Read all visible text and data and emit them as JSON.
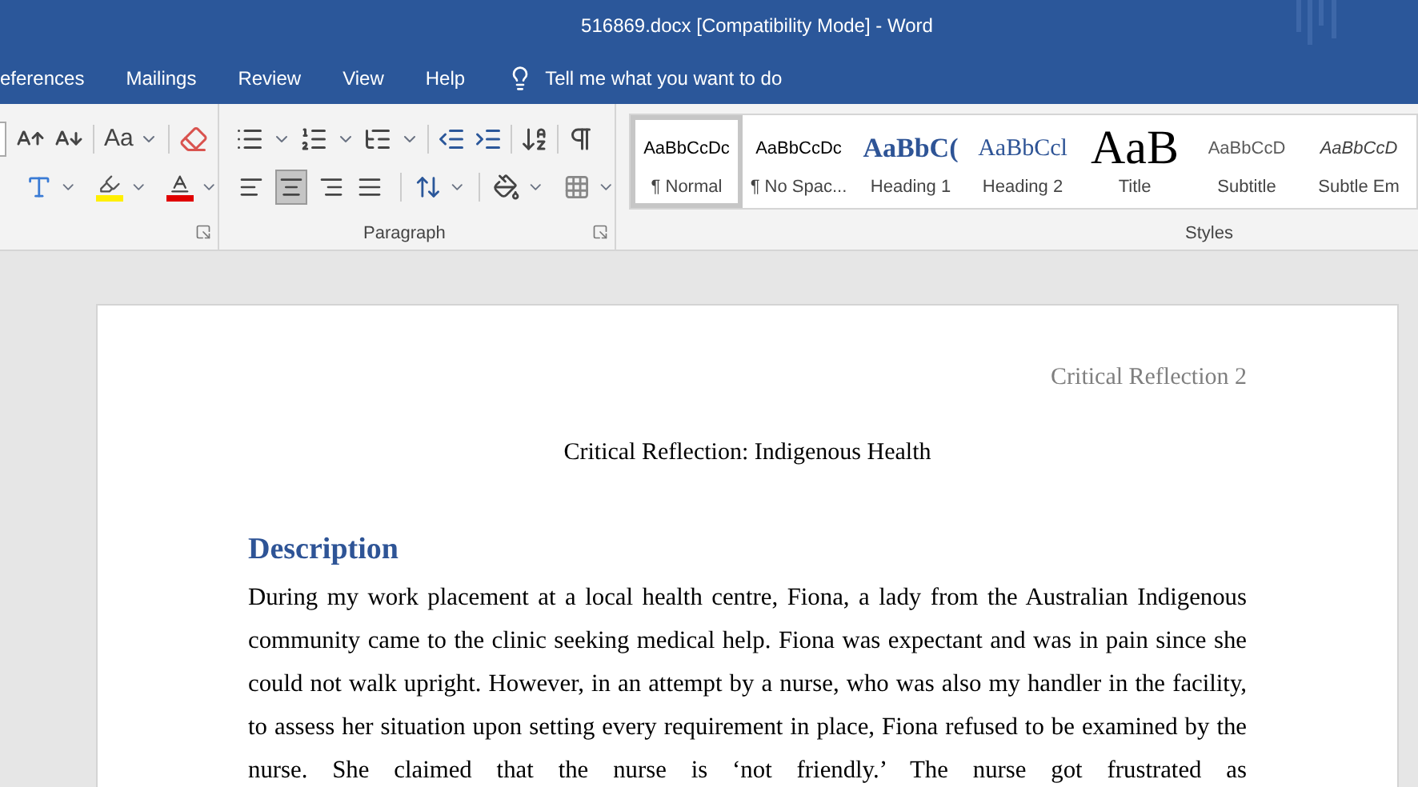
{
  "window": {
    "title": "516869.docx [Compatibility Mode]  -  Word"
  },
  "tabs": [
    {
      "label": "eferences"
    },
    {
      "label": "Mailings"
    },
    {
      "label": "Review"
    },
    {
      "label": "View"
    },
    {
      "label": "Help"
    }
  ],
  "tell_me": {
    "placeholder": "Tell me what you want to do"
  },
  "font_group": {
    "change_case": "Aa"
  },
  "paragraph_group": {
    "label": "Paragraph",
    "alignment": [
      {
        "kind": "left",
        "selected": false
      },
      {
        "kind": "center",
        "selected": true
      },
      {
        "kind": "right",
        "selected": false
      },
      {
        "kind": "justify",
        "selected": false
      }
    ]
  },
  "styles_group": {
    "label": "Styles",
    "styles": [
      {
        "sample": "AaBbCcDc",
        "name": "¶ Normal",
        "kind": "normal",
        "selected": true
      },
      {
        "sample": "AaBbCcDc",
        "name": "¶ No Spac...",
        "kind": "normal",
        "selected": false
      },
      {
        "sample": "AaBbC(",
        "name": "Heading 1",
        "kind": "heading1",
        "selected": false
      },
      {
        "sample": "AaBbCcl",
        "name": "Heading 2",
        "kind": "heading2",
        "selected": false
      },
      {
        "sample": "AaB",
        "name": "Title",
        "kind": "title",
        "selected": false
      },
      {
        "sample": "AaBbCcD",
        "name": "Subtitle",
        "kind": "subtitle",
        "selected": false
      },
      {
        "sample": "AaBbCcD",
        "name": "Subtle Em",
        "kind": "emphasis",
        "selected": false
      }
    ]
  },
  "document": {
    "header": "Critical Reflection 2",
    "title": "Critical Reflection: Indigenous Health",
    "heading": "Description",
    "paragraph": "During my work placement at a local health centre, Fiona, a lady from the Australian Indigenous community came to the clinic seeking medical help. Fiona was expectant and was in pain since she could not walk upright. However, in an attempt by a nurse, who was also my handler in the facility, to assess her situation upon setting every requirement in place, Fiona refused to be examined by the nurse. She claimed that the nurse is ‘not friendly.’ The nurse got frustrated as"
  }
}
